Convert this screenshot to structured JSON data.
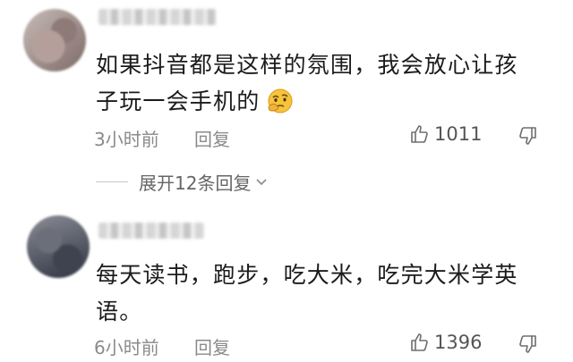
{
  "comments": [
    {
      "text_line1": "如果抖音都是这样的氛围，我会放心让孩",
      "text_line2": "子玩一会手机的",
      "emoji": "thinking-face-emoji",
      "time": "3小时前",
      "reply_label": "回复",
      "like_count": "1011",
      "expand_label": "展开12条回复"
    },
    {
      "text_line1": "每天读书，跑步，吃大米，吃完大米学英",
      "text_line2": "语。",
      "time": "6小时前",
      "reply_label": "回复",
      "like_count": "1396"
    }
  ],
  "icons": {
    "like": "thumbs-up-icon",
    "dislike": "thumbs-down-icon",
    "expand": "chevron-down-icon"
  },
  "colors": {
    "text": "#1b1b1b",
    "meta": "#8a8a8a",
    "emoji": "#f6c33b"
  }
}
